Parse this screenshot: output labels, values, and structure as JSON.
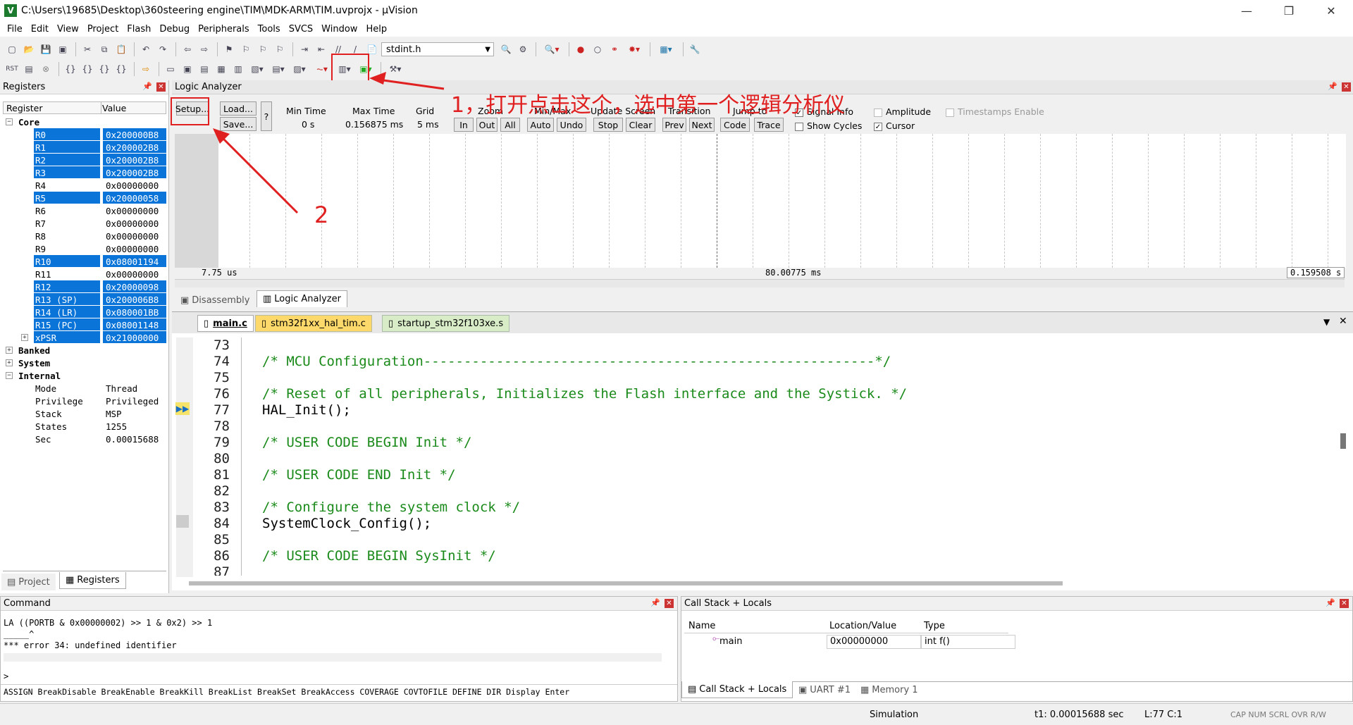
{
  "window": {
    "title": "C:\\Users\\19685\\Desktop\\360steering engine\\TIM\\MDK-ARM\\TIM.uvprojx - µVision",
    "app_icon": "V",
    "min": "—",
    "max": "❐",
    "close": "✕"
  },
  "menu": [
    "File",
    "Edit",
    "View",
    "Project",
    "Flash",
    "Debug",
    "Peripherals",
    "Tools",
    "SVCS",
    "Window",
    "Help"
  ],
  "toolbar": {
    "file_combo": "stdint.h"
  },
  "registers": {
    "title": "Registers",
    "col_register": "Register",
    "col_value": "Value",
    "rows": [
      {
        "name": "Core",
        "value": "",
        "group": true,
        "sign": "−"
      },
      {
        "name": "R0",
        "value": "0x200000B8",
        "sel": true
      },
      {
        "name": "R1",
        "value": "0x200002B8",
        "sel": true
      },
      {
        "name": "R2",
        "value": "0x200002B8",
        "sel": true
      },
      {
        "name": "R3",
        "value": "0x200002B8",
        "sel": true
      },
      {
        "name": "R4",
        "value": "0x00000000",
        "sel": false
      },
      {
        "name": "R5",
        "value": "0x20000058",
        "sel": true
      },
      {
        "name": "R6",
        "value": "0x00000000",
        "sel": false
      },
      {
        "name": "R7",
        "value": "0x00000000",
        "sel": false
      },
      {
        "name": "R8",
        "value": "0x00000000",
        "sel": false
      },
      {
        "name": "R9",
        "value": "0x00000000",
        "sel": false
      },
      {
        "name": "R10",
        "value": "0x08001194",
        "sel": true
      },
      {
        "name": "R11",
        "value": "0x00000000",
        "sel": false
      },
      {
        "name": "R12",
        "value": "0x20000098",
        "sel": true
      },
      {
        "name": "R13 (SP)",
        "value": "0x200006B8",
        "sel": true
      },
      {
        "name": "R14 (LR)",
        "value": "0x080001BB",
        "sel": true
      },
      {
        "name": "R15 (PC)",
        "value": "0x08001148",
        "sel": true
      },
      {
        "name": "xPSR",
        "value": "0x21000000",
        "sel": true,
        "sign": "+"
      },
      {
        "name": "Banked",
        "value": "",
        "group": true,
        "sign": "+"
      },
      {
        "name": "System",
        "value": "",
        "group": true,
        "sign": "+"
      },
      {
        "name": "Internal",
        "value": "",
        "group": true,
        "sign": "−"
      },
      {
        "name": "Mode",
        "value": "Thread",
        "sel": false
      },
      {
        "name": "Privilege",
        "value": "Privileged",
        "sel": false
      },
      {
        "name": "Stack",
        "value": "MSP",
        "sel": false
      },
      {
        "name": "States",
        "value": "1255",
        "sel": false
      },
      {
        "name": "Sec",
        "value": "0.00015688",
        "sel": false
      }
    ],
    "tab_project": "Project",
    "tab_registers": "Registers"
  },
  "logic_analyzer": {
    "title": "Logic Analyzer",
    "setup": "Setup...",
    "load": "Load...",
    "save": "Save...",
    "help": "?",
    "min_time_label": "Min Time",
    "min_time": "0 s",
    "max_time_label": "Max Time",
    "max_time": "0.156875 ms",
    "grid_label": "Grid",
    "grid": "5 ms",
    "zoom_label": "Zoom",
    "zoom_in": "In",
    "zoom_out": "Out",
    "zoom_all": "All",
    "minmax_label": "Min/Max",
    "auto": "Auto",
    "undo": "Undo",
    "update_label": "Update Screen",
    "stop": "Stop",
    "clear": "Clear",
    "transition_label": "Transition",
    "prev": "Prev",
    "next": "Next",
    "jumpto_label": "Jump to",
    "code": "Code",
    "trace": "Trace",
    "signal_info": "Signal Info",
    "show_cycles": "Show Cycles",
    "amplitude": "Amplitude",
    "cursor": "Cursor",
    "timestamps": "Timestamps Enable",
    "time_left": "7.75 us",
    "time_mid": "80.00775 ms",
    "time_right": "0.159508 s"
  },
  "annotations": {
    "note1": "1，打开点击这个，选中第一个逻辑分析仪",
    "note2": "2"
  },
  "view_tabs": {
    "disassembly": "Disassembly",
    "logic": "Logic Analyzer"
  },
  "editor": {
    "tabs": [
      "main.c",
      "stm32f1xx_hal_tim.c",
      "startup_stm32f103xe.s"
    ],
    "lines": [
      {
        "n": "73",
        "code": "",
        "cmt": ""
      },
      {
        "n": "74",
        "code": "",
        "cmt": "/* MCU Configuration--------------------------------------------------------*/"
      },
      {
        "n": "75",
        "code": "",
        "cmt": ""
      },
      {
        "n": "76",
        "code": "",
        "cmt": "/* Reset of all peripherals, Initializes the Flash interface and the Systick. */"
      },
      {
        "n": "77",
        "code": "HAL_Init();",
        "cmt": ""
      },
      {
        "n": "78",
        "code": "",
        "cmt": ""
      },
      {
        "n": "79",
        "code": "",
        "cmt": "/* USER CODE BEGIN Init */"
      },
      {
        "n": "80",
        "code": "",
        "cmt": ""
      },
      {
        "n": "81",
        "code": "",
        "cmt": "/* USER CODE END Init */"
      },
      {
        "n": "82",
        "code": "",
        "cmt": ""
      },
      {
        "n": "83",
        "code": "",
        "cmt": "/* Configure the system clock */"
      },
      {
        "n": "84",
        "code": "SystemClock_Config();",
        "cmt": ""
      },
      {
        "n": "85",
        "code": "",
        "cmt": ""
      },
      {
        "n": "86",
        "code": "",
        "cmt": "/* USER CODE BEGIN SysInit */"
      },
      {
        "n": "87",
        "code": "",
        "cmt": ""
      }
    ]
  },
  "command": {
    "title": "Command",
    "line1": "LA ((PORTB & 0x00000002) >> 1 & 0x2) >> 1",
    "line2": "_____^",
    "line3": "*** error 34: undefined identifier",
    "prompt": ">",
    "hints": "ASSIGN BreakDisable BreakEnable BreakKill BreakList BreakSet BreakAccess COVERAGE COVTOFILE DEFINE DIR Display Enter"
  },
  "callstack": {
    "title": "Call Stack + Locals",
    "col_name": "Name",
    "col_loc": "Location/Value",
    "col_type": "Type",
    "row_name": "main",
    "row_loc": "0x00000000",
    "row_type": "int f()",
    "tab1": "Call Stack + Locals",
    "tab2": "UART #1",
    "tab3": "Memory 1"
  },
  "status": {
    "mode": "Simulation",
    "t1": "t1: 0.00015688 sec",
    "pos": "L:77 C:1",
    "caps": "CAP NUM SCRL OVR R/W"
  }
}
